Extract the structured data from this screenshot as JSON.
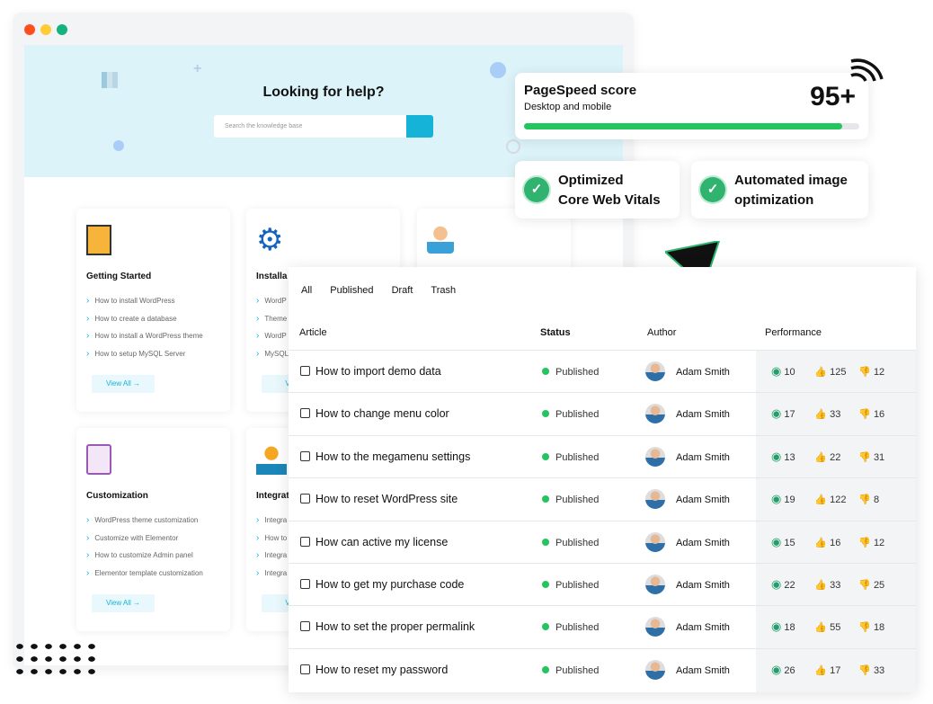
{
  "window": {
    "controls": [
      "#ff4f1f",
      "#ffcc33",
      "#14b37d"
    ]
  },
  "hero": {
    "title": "Looking for help?",
    "search_placeholder": "Search the knowledge base"
  },
  "cards": [
    {
      "title": "Getting Started",
      "items": [
        "How to install WordPress",
        "How to create a database",
        "How to install a WordPress theme",
        "How to setup MySQL Server"
      ],
      "button": "View All →"
    },
    {
      "title": "Installa",
      "items": [
        "WordP",
        "Theme",
        "WordP",
        "MySQL"
      ],
      "button": "View"
    },
    {
      "title": "",
      "items": [],
      "button": ""
    },
    {
      "title": "Customization",
      "items": [
        "WordPress theme customization",
        "Customize with Elementor",
        "How to customize Admin panel",
        "Elementor template customization"
      ],
      "button": "View All →"
    },
    {
      "title": "Integrat",
      "items": [
        "Integra",
        "How to",
        "Integra",
        "Integra"
      ],
      "button": "View"
    }
  ],
  "pagespeed": {
    "title": "PageSpeed score",
    "subtitle": "Desktop and mobile",
    "score": "95+",
    "progress_percent": 95
  },
  "vitals": [
    {
      "line1": "Optimized",
      "line2": "Core Web Vitals"
    },
    {
      "line1": "Automated image",
      "line2": "optimization"
    }
  ],
  "table": {
    "tabs": [
      "All",
      "Published",
      "Draft",
      "Trash"
    ],
    "columns": [
      "Article",
      "Status",
      "Author",
      "Performance"
    ],
    "rows": [
      {
        "title": "How to import demo data",
        "status": "Published",
        "author": "Adam Smith",
        "views": "10",
        "likes": "125",
        "dislikes": "12"
      },
      {
        "title": "How to change menu color",
        "status": "Published",
        "author": "Adam Smith",
        "views": "17",
        "likes": "33",
        "dislikes": "16"
      },
      {
        "title": "How to the megamenu settings",
        "status": "Published",
        "author": "Adam Smith",
        "views": "13",
        "likes": "22",
        "dislikes": "31"
      },
      {
        "title": "How to reset WordPress site",
        "status": "Published",
        "author": "Adam Smith",
        "views": "19",
        "likes": "122",
        "dislikes": "8"
      },
      {
        "title": "How can active my license",
        "status": "Published",
        "author": "Adam Smith",
        "views": "15",
        "likes": "16",
        "dislikes": "12"
      },
      {
        "title": "How to get my purchase code",
        "status": "Published",
        "author": "Adam Smith",
        "views": "22",
        "likes": "33",
        "dislikes": "25"
      },
      {
        "title": "How to set the proper permalink",
        "status": "Published",
        "author": "Adam Smith",
        "views": "18",
        "likes": "55",
        "dislikes": "18"
      },
      {
        "title": "How to reset my password",
        "status": "Published",
        "author": "Adam Smith",
        "views": "26",
        "likes": "17",
        "dislikes": "33"
      }
    ]
  }
}
